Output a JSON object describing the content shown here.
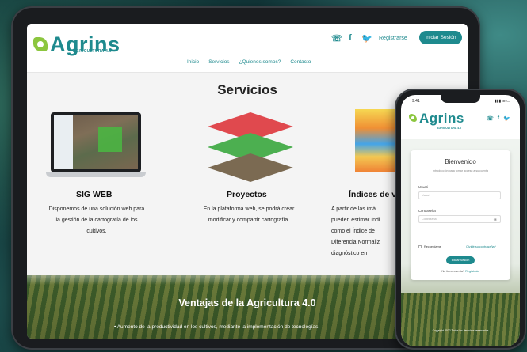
{
  "header": {
    "logo_text": "Agrins",
    "logo_sub": "AGRICULTURA 4.0",
    "social": [
      "☏",
      "f",
      "🐦"
    ],
    "register": "Registrarse",
    "login": "Iniciar Sesión",
    "nav": [
      "Inicio",
      "Servicios",
      "¿Quienes somos?",
      "Contacto"
    ]
  },
  "services": {
    "title": "Servicios",
    "items": [
      {
        "title": "SIG WEB",
        "desc": [
          "Disponemos de una solución web para",
          "la gestión de la cartografía de los",
          "cultivos."
        ]
      },
      {
        "title": "Proyectos",
        "desc": [
          "En la plataforma web, se podrá crear",
          "modificar y compartir cartografía."
        ]
      },
      {
        "title": "Índices de v",
        "desc": [
          "A partir de las imá",
          "pueden estimar índi",
          "como el Índice de",
          "Diferencia Normaliz",
          "diagnóstico en"
        ]
      }
    ]
  },
  "advantages": {
    "title": "Ventajas de la Agricultura 4.0",
    "bullet": "• Aumento de la productividad en los cultivos, mediante la implementación de tecnologías."
  },
  "phone": {
    "time": "9:41",
    "status_right": "▮▮▮ ≋ ▭",
    "logo_text": "Agrins",
    "logo_sub": "AGRICULTURA 4.0",
    "social": [
      "☏",
      "f",
      "🐦"
    ],
    "card_title": "Bienvenido",
    "card_sub": "Introducción para tomar acceso a su cuenta",
    "user_label": "Usuari",
    "user_placeholder": "Usuari",
    "pass_label": "Contraseña",
    "pass_placeholder": "Contraseña",
    "remember": "Recuerdame",
    "forgot": "Olvidé su contraseña?",
    "login_button": "Iniciar Sesión",
    "no_account": "No tiene cuenta?",
    "register_link": "Regístrate",
    "copyright": "Copyright 2022 Todos los derechos reservados"
  }
}
